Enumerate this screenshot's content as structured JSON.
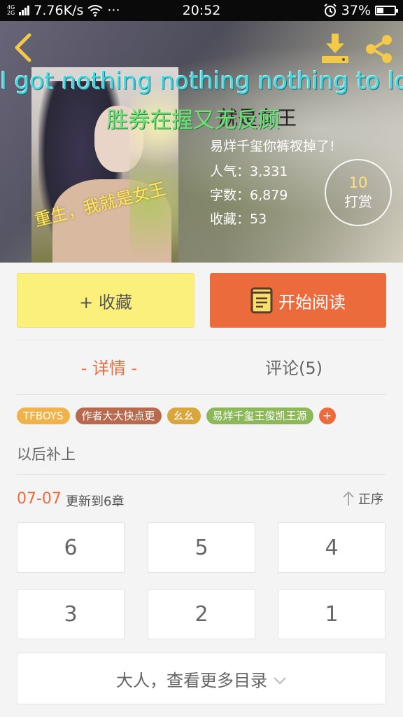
{
  "status_bar": {
    "network_type": "4G",
    "speed": "7.76K/s",
    "more": "···",
    "time": "20:52",
    "battery": "37%"
  },
  "book": {
    "title_overlay_en": "I got nothing nothing nothing to lose",
    "title_overlay_zh": "胜券在握又无反顾",
    "title_partial": "就是女王",
    "cover_text": "重生，我就是女王",
    "author": "易烊千玺你裤衩掉了!",
    "popularity": "人气：3,331",
    "word_count": "字数：6,879",
    "favorites": "收藏：53",
    "tip_count": "10",
    "tip_label": "打赏"
  },
  "actions": {
    "favorite": "+ 收藏",
    "start_reading": "开始阅读"
  },
  "tabs": {
    "detail": "- 详情 -",
    "comments": "评论(5)"
  },
  "tags": [
    "TFBOYS",
    "作者大大快点更",
    "幺幺",
    "易烊千玺王俊凯王源"
  ],
  "tag_add": "+",
  "intro": "以后补上",
  "update": {
    "date": "07-07",
    "text": "更新到6章",
    "sort_label": "正序"
  },
  "chapters": [
    "6",
    "5",
    "4",
    "3",
    "2",
    "1"
  ],
  "more_catalog": "大人，查看更多目录",
  "colors": {
    "accent": "#ec6b3d",
    "favorite_button": "#fbf07b",
    "title_en": "#4cd4d8",
    "title_zh": "#6fe27a"
  }
}
